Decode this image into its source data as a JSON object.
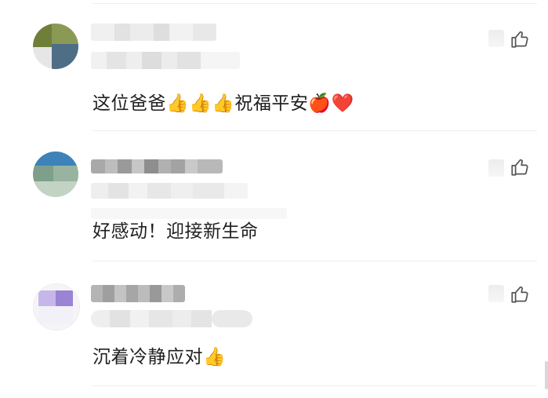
{
  "comments": [
    {
      "text": "这位爸爸👍👍👍祝福平安🍎❤️",
      "avatar_colors": [
        "#6f7f3a",
        "#4e6e86",
        "#c8c8c8",
        "#e0e0e0"
      ]
    },
    {
      "text": "好感动！迎接新生命",
      "avatar_colors": [
        "#3d82b9",
        "#8da893",
        "#b9cdbc",
        "#e9ece9"
      ]
    },
    {
      "text": "沉着冷静应对👍",
      "avatar_colors": [
        "#9b83d6",
        "#c7b6ea",
        "#f3f1f8",
        "#ffffff"
      ]
    }
  ],
  "like": {
    "icon": "thumbs-up-outline-icon",
    "color": "#555555"
  }
}
